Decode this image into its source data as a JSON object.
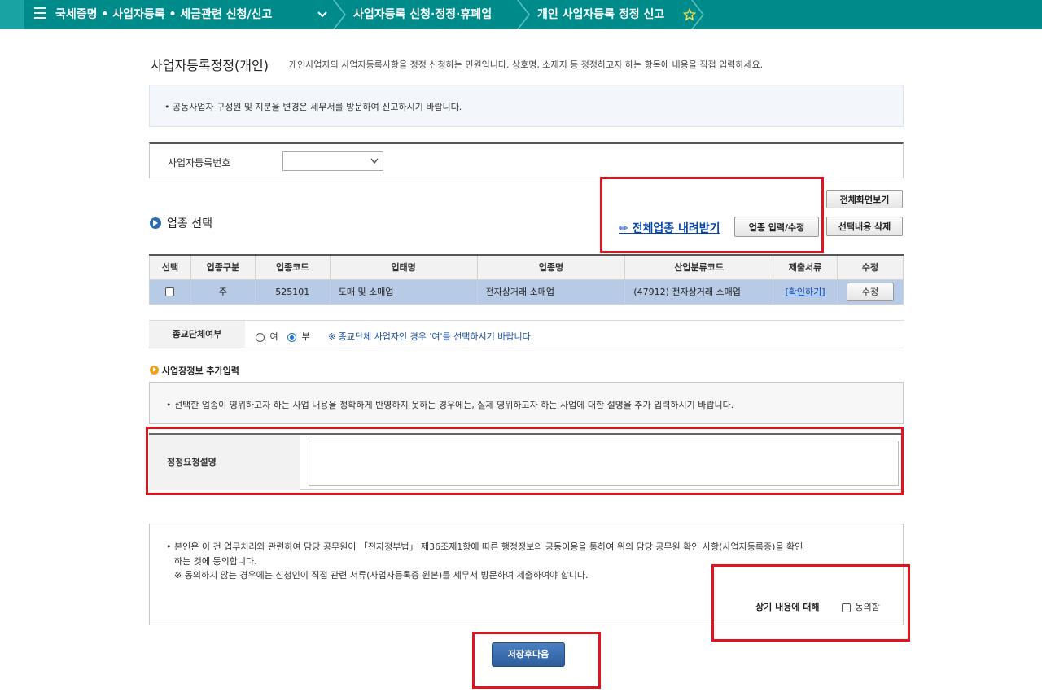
{
  "nav": {
    "crumb1": "국세증명 • 사업자등록 • 세금관련 신청/신고",
    "crumb2": "사업자등록 신청·정정·휴폐업",
    "crumb3": "개인 사업자등록 정정 신고"
  },
  "page": {
    "title": "사업자등록정정(개인)",
    "description": "개인사업자의 사업자등록사항을 정정 신청하는 민원입니다. 상호명, 소재지 등 정정하고자 하는 항목에 내용을 직접 입력하세요.",
    "notice": "• 공동사업자 구성원 및 지분율 변경은 세무서를 방문하여 신고하시기 바랍니다."
  },
  "registration": {
    "label": "사업자등록번호",
    "selected_value": ""
  },
  "industry": {
    "section_title": "업종 선택",
    "download_link": "✏ 전체업종 내려받기",
    "input_button": "업종 입력/수정",
    "fullscreen_button": "전체화면보기",
    "delete_button": "선택내용 삭제",
    "columns": [
      "선택",
      "업종구분",
      "업종코드",
      "업태명",
      "업종명",
      "산업분류코드",
      "제출서류",
      "수정"
    ],
    "rows": [
      {
        "kind": "주",
        "code": "525101",
        "business_type": "도매 및 소매업",
        "business_name": "전자상거래 소매업",
        "class_code": "(47912) 전자상거래 소매업",
        "docs_link": "[확인하기]",
        "edit_button": "수정"
      }
    ]
  },
  "religious": {
    "label": "종교단체여부",
    "option_yes": "여",
    "option_no": "부",
    "selected": "부",
    "hint": "※ 종교단체 사업자인 경우 '여'를 선택하시기 바랍니다."
  },
  "extra": {
    "title": "사업장정보 추가입력",
    "notice": "• 선택한 업종이 영위하고자 하는 사업 내용을 정확하게 반영하지 못하는 경우에는, 실제 영위하고자 하는 사업에 대한 설명을 추가 입력하시기 바랍니다.",
    "request_label": "정정요청설명",
    "request_value": ""
  },
  "consent": {
    "line1": "• 본인은 이 건 업무처리와 관련하여 담당 공무원이 「전자정부법」 제36조제1항에 따른 행정정보의 공동이용을 통하여 위의 담당 공무원 확인 사항(사업자등록증)을 확인",
    "line2": "하는 것에 동의합니다.",
    "line3": "※  동의하지 않는 경우에는 신청인이 직접 관련 서류(사업자등록증 원본)를 세무서 방문하여 제출하여야 합니다.",
    "agree_prompt": "상기 내용에 대해",
    "agree_label": "동의함"
  },
  "actions": {
    "save_next": "저장후다음"
  },
  "colors": {
    "nav_bg": "#008b8b",
    "row_highlight": "#b7cbe6",
    "annotation_red": "#e0141e",
    "primary_button": "#2d5d9b"
  }
}
